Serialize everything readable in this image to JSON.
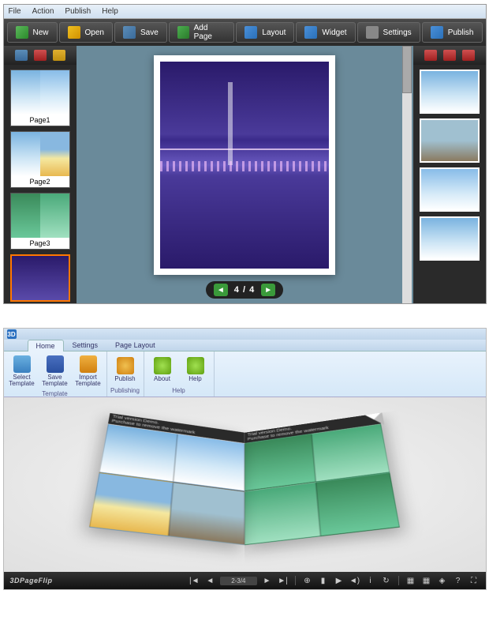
{
  "app1": {
    "menu": {
      "file": "File",
      "action": "Action",
      "publish": "Publish",
      "help": "Help"
    },
    "toolbar": {
      "new": "New",
      "open": "Open",
      "save": "Save",
      "addPage": "Add Page",
      "layout": "Layout",
      "widget": "Widget",
      "settings": "Settings",
      "publish": "Publish"
    },
    "pages": [
      {
        "label": "Page1"
      },
      {
        "label": "Page2"
      },
      {
        "label": "Page3"
      }
    ],
    "pager": {
      "current": "4",
      "sep": " / ",
      "total": "4"
    }
  },
  "app2": {
    "logo": "3D",
    "tabs": {
      "home": "Home",
      "settings": "Settings",
      "pageLayout": "Page Layout"
    },
    "ribbon": {
      "selectTemplate": "Select Template",
      "saveTemplate": "Save Template",
      "importTemplate": "Import Template",
      "publish": "Publish",
      "about": "About",
      "help": "Help",
      "groupTemplate": "Template",
      "groupPublishing": "Publishing",
      "groupHelp": "Help"
    },
    "watermark": {
      "line1": "Trial version Demo.",
      "line2": "Purchase to remove the watermark"
    },
    "brand": "3DPageFlip",
    "pageRange": "2-3/4"
  }
}
